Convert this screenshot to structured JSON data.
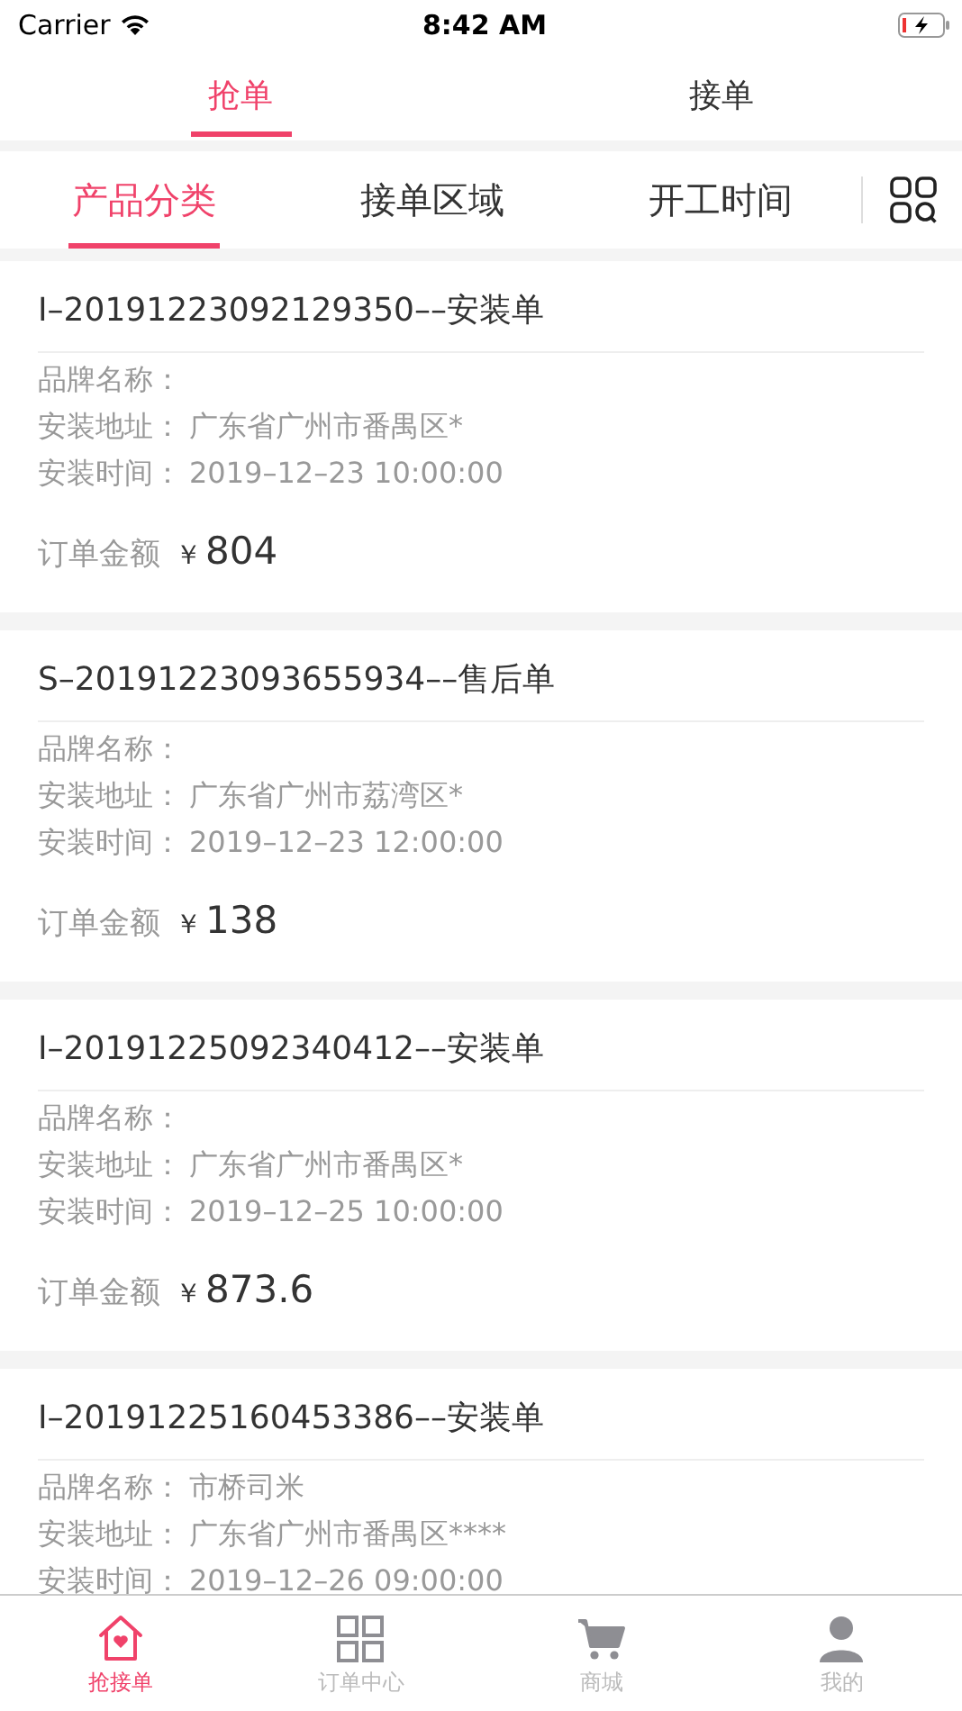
{
  "status_bar": {
    "carrier": "Carrier",
    "time": "8:42 AM"
  },
  "top_tabs": [
    {
      "label": "抢单",
      "selected": true
    },
    {
      "label": "接单",
      "selected": false
    }
  ],
  "filters": [
    {
      "label": "产品分类",
      "selected": true
    },
    {
      "label": "接单区域",
      "selected": false
    },
    {
      "label": "开工时间",
      "selected": false
    }
  ],
  "orders": [
    {
      "title": "I–20191223092129350––安装单",
      "fields": [
        {
          "label": "品牌名称："
        },
        {
          "label": "安装地址：",
          "value": "广东省广州市番禺区*"
        },
        {
          "label": "安装时间：",
          "value": "2019–12–23 10:00:00"
        }
      ],
      "amount_label": "订单金额",
      "currency": "￥",
      "amount": "804"
    },
    {
      "title": "S–20191223093655934––售后单",
      "fields": [
        {
          "label": "品牌名称："
        },
        {
          "label": "安装地址：",
          "value": "广东省广州市荔湾区*"
        },
        {
          "label": "安装时间：",
          "value": "2019–12–23 12:00:00"
        }
      ],
      "amount_label": "订单金额",
      "currency": "￥",
      "amount": "138"
    },
    {
      "title": "I–20191225092340412––安装单",
      "fields": [
        {
          "label": "品牌名称："
        },
        {
          "label": "安装地址：",
          "value": "广东省广州市番禺区*"
        },
        {
          "label": "安装时间：",
          "value": "2019–12–25 10:00:00"
        }
      ],
      "amount_label": "订单金额",
      "currency": "￥",
      "amount": "873.6"
    },
    {
      "title": "I–20191225160453386––安装单",
      "fields": [
        {
          "label": "品牌名称：",
          "value": "市桥司米"
        },
        {
          "label": "安装地址：",
          "value": "广东省广州市番禺区****"
        },
        {
          "label": "安装时间：",
          "value": "2019–12–26 09:00:00"
        }
      ]
    }
  ],
  "tab_bar": [
    {
      "label": "抢接单",
      "kind": "home",
      "selected": true
    },
    {
      "label": "订单中心",
      "kind": "grid",
      "selected": false
    },
    {
      "label": "商城",
      "kind": "cart",
      "selected": false
    },
    {
      "label": "我的",
      "kind": "person",
      "selected": false
    }
  ]
}
